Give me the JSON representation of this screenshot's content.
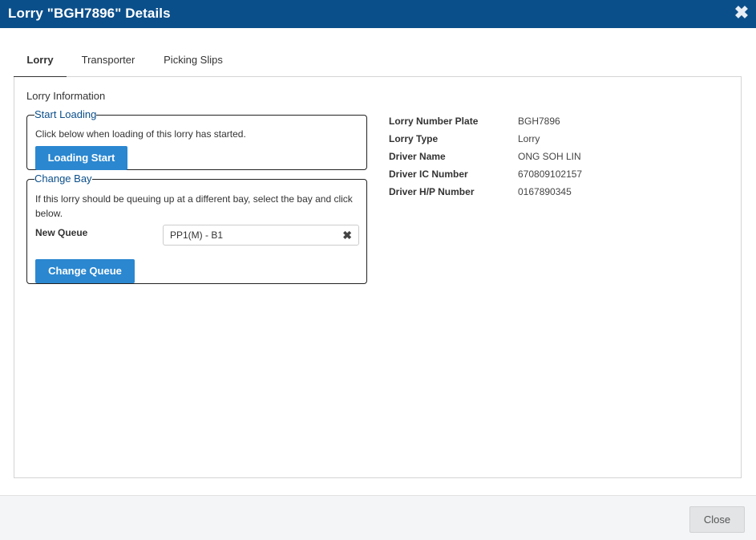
{
  "dialog": {
    "title": "Lorry \"BGH7896\" Details",
    "close_icon": "close-icon"
  },
  "tabs": [
    {
      "label": "Lorry",
      "active": true
    },
    {
      "label": "Transporter",
      "active": false
    },
    {
      "label": "Picking Slips",
      "active": false
    }
  ],
  "lorry_info": {
    "section_title": "Lorry Information",
    "start_loading": {
      "legend": "Start Loading",
      "description": "Click below when loading of this lorry has started.",
      "button": "Loading Start"
    },
    "change_bay": {
      "legend": "Change Bay",
      "description": "If this lorry should be queuing up at a different bay, select the bay and click below.",
      "new_queue_label": "New Queue",
      "new_queue_value": "PP1(M) - B1",
      "button": "Change Queue"
    },
    "details": [
      {
        "label": "Lorry Number Plate",
        "value": "BGH7896"
      },
      {
        "label": "Lorry Type",
        "value": "Lorry"
      },
      {
        "label": "Driver Name",
        "value": "ONG SOH LIN"
      },
      {
        "label": "Driver IC Number",
        "value": "670809102157"
      },
      {
        "label": "Driver H/P Number",
        "value": "0167890345"
      }
    ]
  },
  "footer": {
    "close_button": "Close"
  },
  "colors": {
    "titlebar": "#0b4f8a",
    "primary_button": "#2a87d0",
    "legend_text": "#0b4f8a"
  }
}
